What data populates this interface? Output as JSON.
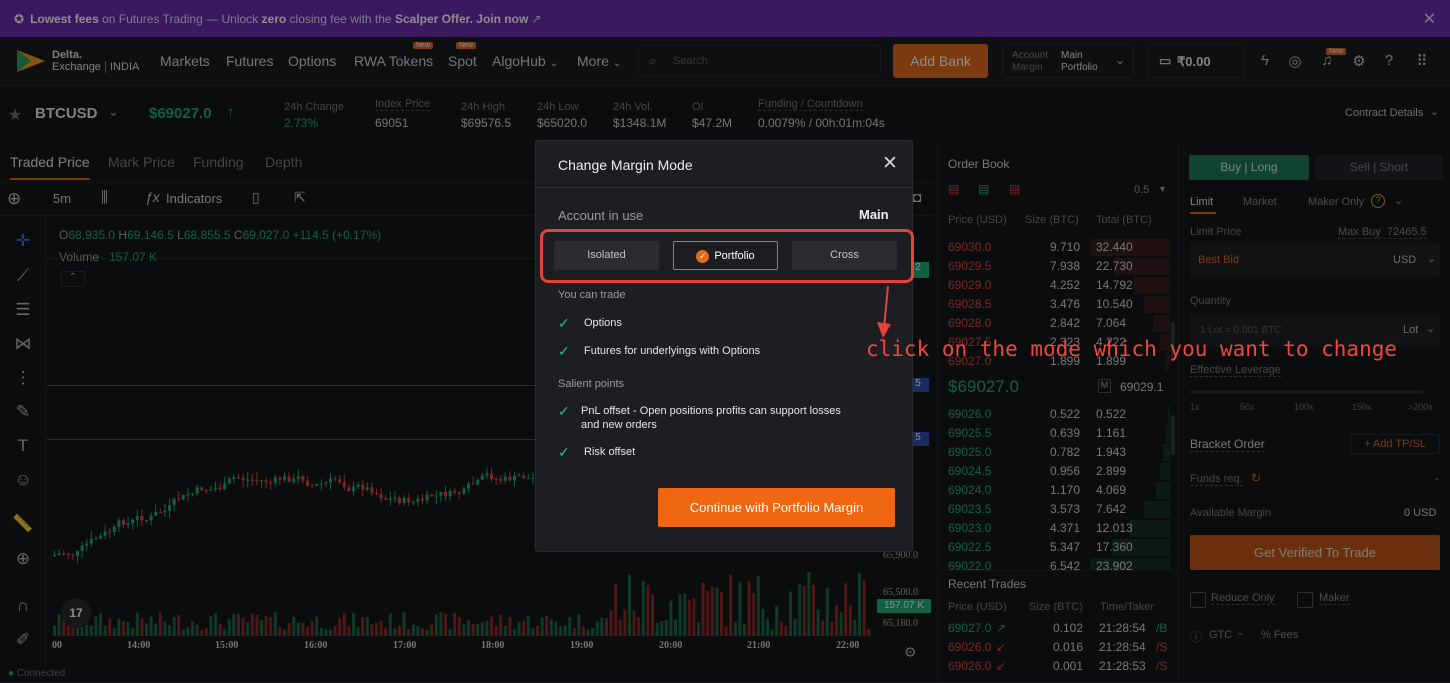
{
  "promo": {
    "lead": "Lowest fees",
    "t1": " on Futures Trading — Unlock ",
    "zero": "zero",
    "t2": " closing fee with the ",
    "offer": "Scalper Offer. Join now",
    "link_icon": "external-link-icon",
    "close": "✕"
  },
  "nav": {
    "logo_line1": "Delta.",
    "logo_line2": "Exchange",
    "logo_region": "INDIA",
    "markets": "Markets",
    "futures": "Futures",
    "options": "Options",
    "rwa": "RWA Tokens",
    "spot": "Spot",
    "algohub": "AlgoHub",
    "more": "More",
    "new_tag": "New",
    "search_placeholder": "Search",
    "add_bank": "Add Bank",
    "account_label1": "Account",
    "account_label2": "Margin",
    "account_val1": "Main",
    "account_val2": "Portfolio",
    "wallet": "₹0.00"
  },
  "ticker": {
    "symbol": "BTCUSD",
    "price": "$69027.0",
    "change_label": "24h Change",
    "change_val": "2.73%",
    "index_label": "Index Price",
    "index_val": "69051",
    "high_label": "24h High",
    "high_val": "$69576.5",
    "low_label": "24h Low",
    "low_val": "$65020.0",
    "vol_label": "24h Vol.",
    "vol_val": "$1348.1M",
    "oi_label": "OI",
    "oi_val": "$47.2M",
    "funding_label": "Funding / Countdown",
    "funding_val": "0.0079% / 00h:01m:04s",
    "contract_details": "Contract Details"
  },
  "chart_tabs": {
    "traded": "Traded Price",
    "mark": "Mark Price",
    "funding": "Funding",
    "depth": "Depth"
  },
  "toolbar": {
    "interval": "5m",
    "indicators": "Indicators"
  },
  "chart": {
    "ohlc_o": "68,935.0",
    "ohlc_h": "69,146.5",
    "ohlc_l": "68,855.5",
    "ohlc_c": "69,027.0",
    "ohlc_chg": "+114.5 (+0.17%)",
    "volume_label": "Volume",
    "volume_val": "157.07 K",
    "y1": "65,900.0",
    "y2": "65,500.0",
    "y3": "65,180.0",
    "vol_badge": "157.07 K",
    "partial_y_top": "2",
    "partial_y_mid": "5",
    "times": [
      "00",
      "14:00",
      "15:00",
      "16:00",
      "17:00",
      "18:00",
      "19:00",
      "20:00",
      "21:00",
      "22:00"
    ],
    "status": "Connected",
    "tv_logo": "17"
  },
  "orderbook": {
    "title": "Order Book",
    "tick": "0.5",
    "col_price": "Price (USD)",
    "col_size": "Size (BTC)",
    "col_total": "Total (BTC)",
    "asks": [
      [
        "69030.0",
        "9.710",
        "32.440"
      ],
      [
        "69029.5",
        "7.938",
        "22.730"
      ],
      [
        "69029.0",
        "4.252",
        "14.792"
      ],
      [
        "69028.5",
        "3.476",
        "10.540"
      ],
      [
        "69028.0",
        "2.842",
        "7.064"
      ],
      [
        "69027.5",
        "2.323",
        "4.222"
      ],
      [
        "69027.0",
        "1.899",
        "1.899"
      ]
    ],
    "mid": "$69027.0",
    "mark_letter": "M",
    "mark": "69029.1",
    "bids": [
      [
        "69026.0",
        "0.522",
        "0.522"
      ],
      [
        "69025.5",
        "0.639",
        "1.161"
      ],
      [
        "69025.0",
        "0.782",
        "1.943"
      ],
      [
        "69024.5",
        "0.956",
        "2.899"
      ],
      [
        "69024.0",
        "1.170",
        "4.069"
      ],
      [
        "69023.5",
        "3.573",
        "7.642"
      ],
      [
        "69023.0",
        "4.371",
        "12.013"
      ],
      [
        "69022.5",
        "5.347",
        "17.360"
      ],
      [
        "69022.0",
        "6.542",
        "23.902"
      ]
    ]
  },
  "trades": {
    "title": "Recent Trades",
    "col_price": "Price (USD)",
    "col_size": "Size (BTC)",
    "col_time": "Time/Taker",
    "rows": [
      [
        "69027.0",
        "0.102",
        "21:28:54",
        "/B"
      ],
      [
        "69026.0",
        "0.016",
        "21:28:54",
        "/S"
      ],
      [
        "69026.0",
        "0.001",
        "21:28:53",
        "/S"
      ]
    ]
  },
  "order_panel": {
    "buy": "Buy | Long",
    "sell": "Sell | Short",
    "limit": "Limit",
    "market": "Market",
    "maker_only": "Maker Only",
    "limit_price": "Limit Price",
    "max_buy": "Max Buy  72465.5",
    "best_bid": "Best Bid",
    "usd": "USD",
    "quantity": "Quantity",
    "lot_placeholder": "1 Lot = 0.001 BTC",
    "lot": "Lot",
    "eff_lev": "Effective Leverage",
    "lev_ticks": [
      "1x",
      "50x",
      "100x",
      "150x",
      ">200x"
    ],
    "bracket": "Bracket Order",
    "add_tp": "+ Add TP/SL",
    "funds_req": "Funds req.",
    "dash": "-",
    "avail_margin": "Available Margin",
    "avail_val": "0 USD",
    "verify": "Get Verified To Trade",
    "reduce_only": "Reduce Only",
    "maker": "Maker",
    "gtc": "GTC",
    "fees": "% Fees"
  },
  "modal": {
    "title": "Change Margin Mode",
    "account_in_use": "Account in use",
    "account_val": "Main",
    "isolated": "Isolated",
    "portfolio": "Portfolio",
    "cross": "Cross",
    "you_can_trade": "You can trade",
    "trade1": "Options",
    "trade2": "Futures for underlyings with Options",
    "salient": "Salient points",
    "point1a": "PnL offset - Open positions profits can support losses",
    "point1b": "and new orders",
    "point2": "Risk offset",
    "cta": "Continue with Portfolio Margin"
  },
  "annotation": "click on the mode which you want to change",
  "colors": {
    "accent": "#e8681d",
    "buy": "#22b07d",
    "sell": "#e2473f",
    "promo": "#6b2fb1",
    "annotation": "#f0473a"
  }
}
